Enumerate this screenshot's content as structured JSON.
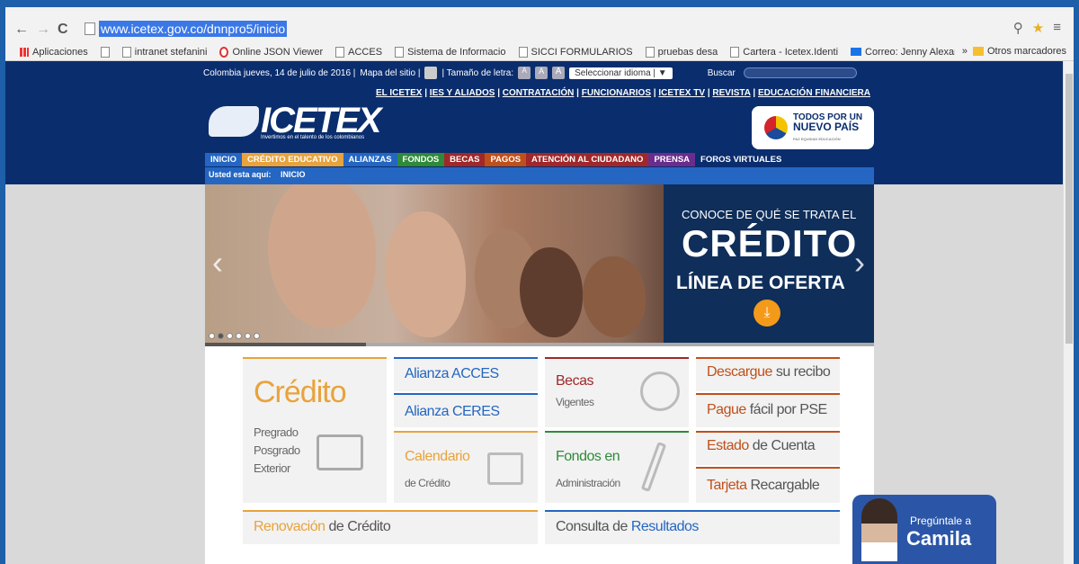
{
  "browser": {
    "url": "www.icetex.gov.co/dnnpro5/inicio",
    "bookmarks": [
      "Aplicaciones",
      "intranet stefanini",
      "Online JSON Viewer",
      "ACCES",
      "Sistema de Informacio",
      "SICCI FORMULARIOS",
      "pruebas desa",
      "Cartera - Icetex.Identi",
      "Correo: Jenny Alexand"
    ],
    "more": "»",
    "other_bookmarks": "Otros marcadores"
  },
  "header": {
    "date_line": "Colombia jueves, 14 de julio de 2016 |",
    "sitemap": "Mapa del sitio |",
    "font_size_label": "| Tamaño de letra:",
    "font_a": [
      "A",
      "A",
      "A"
    ],
    "language": "Seleccionar idioma | ▼",
    "search_label": "Buscar",
    "links": [
      "EL ICETEX",
      "IES Y ALIADOS",
      "CONTRATACIÓN",
      "FUNCIONARIOS",
      "ICETEX TV",
      "REVISTA",
      "EDUCACIÓN FINANCIERA"
    ],
    "logo_text": "ICETEX",
    "logo_tagline": "Invertimos en el talento de los colombianos",
    "tpn_line1": "TODOS POR UN",
    "tpn_line2": "NUEVO PAÍS",
    "tpn_line3": "PAZ EQUIDAD EDUCACIÓN"
  },
  "menu": [
    {
      "label": "INICIO",
      "color": "#2466c2"
    },
    {
      "label": "CRÉDITO EDUCATIVO",
      "color": "#e8a33c"
    },
    {
      "label": "ALIANZAS",
      "color": "#2466c2"
    },
    {
      "label": "FONDOS",
      "color": "#2f8a3a"
    },
    {
      "label": "BECAS",
      "color": "#a0282a"
    },
    {
      "label": "PAGOS",
      "color": "#c0501a"
    },
    {
      "label": "ATENCIÓN AL CIUDADANO",
      "color": "#a0282a"
    },
    {
      "label": "PRENSA",
      "color": "#6a2c8e"
    },
    {
      "label": "FOROS VIRTUALES",
      "color": "#0a2d6e"
    }
  ],
  "breadcrumb": {
    "label": "Usted esta aquí:",
    "current": "INICIO"
  },
  "hero": {
    "line1": "CONOCE DE QUÉ SE TRATA EL",
    "line2": "CRÉDITO",
    "line3": "LÍNEA DE OFERTA",
    "slides": 6,
    "active_slide": 2,
    "progress": 0.24
  },
  "tiles": {
    "credito": "Crédito",
    "credito_sub": [
      "Pregrado",
      "Posgrado",
      "Exterior"
    ],
    "alianza_acces_a": "Alianza",
    "alianza_acces_b": "ACCES",
    "alianza_ceres_a": "Alianza",
    "alianza_ceres_b": "CERES",
    "calendario": "Calendario",
    "calendario_sub": "de Crédito",
    "becas": "Becas",
    "becas_sub": "Vigentes",
    "fondos": "Fondos en",
    "fondos_sub": "Administración",
    "descargue_a": "Descargue",
    "descargue_b": "su recibo",
    "pague_a": "Pague",
    "pague_b": "fácil por PSE",
    "estado_a": "Estado",
    "estado_b": "de Cuenta",
    "tarjeta_a": "Tarjeta",
    "tarjeta_b": "Recargable",
    "renovacion_a": "Renovación",
    "renovacion_b": "de Crédito",
    "consulta_a": "Consulta de",
    "consulta_b": "Resultados"
  },
  "camila": {
    "q": "Pregúntale a",
    "name": "Camila"
  }
}
